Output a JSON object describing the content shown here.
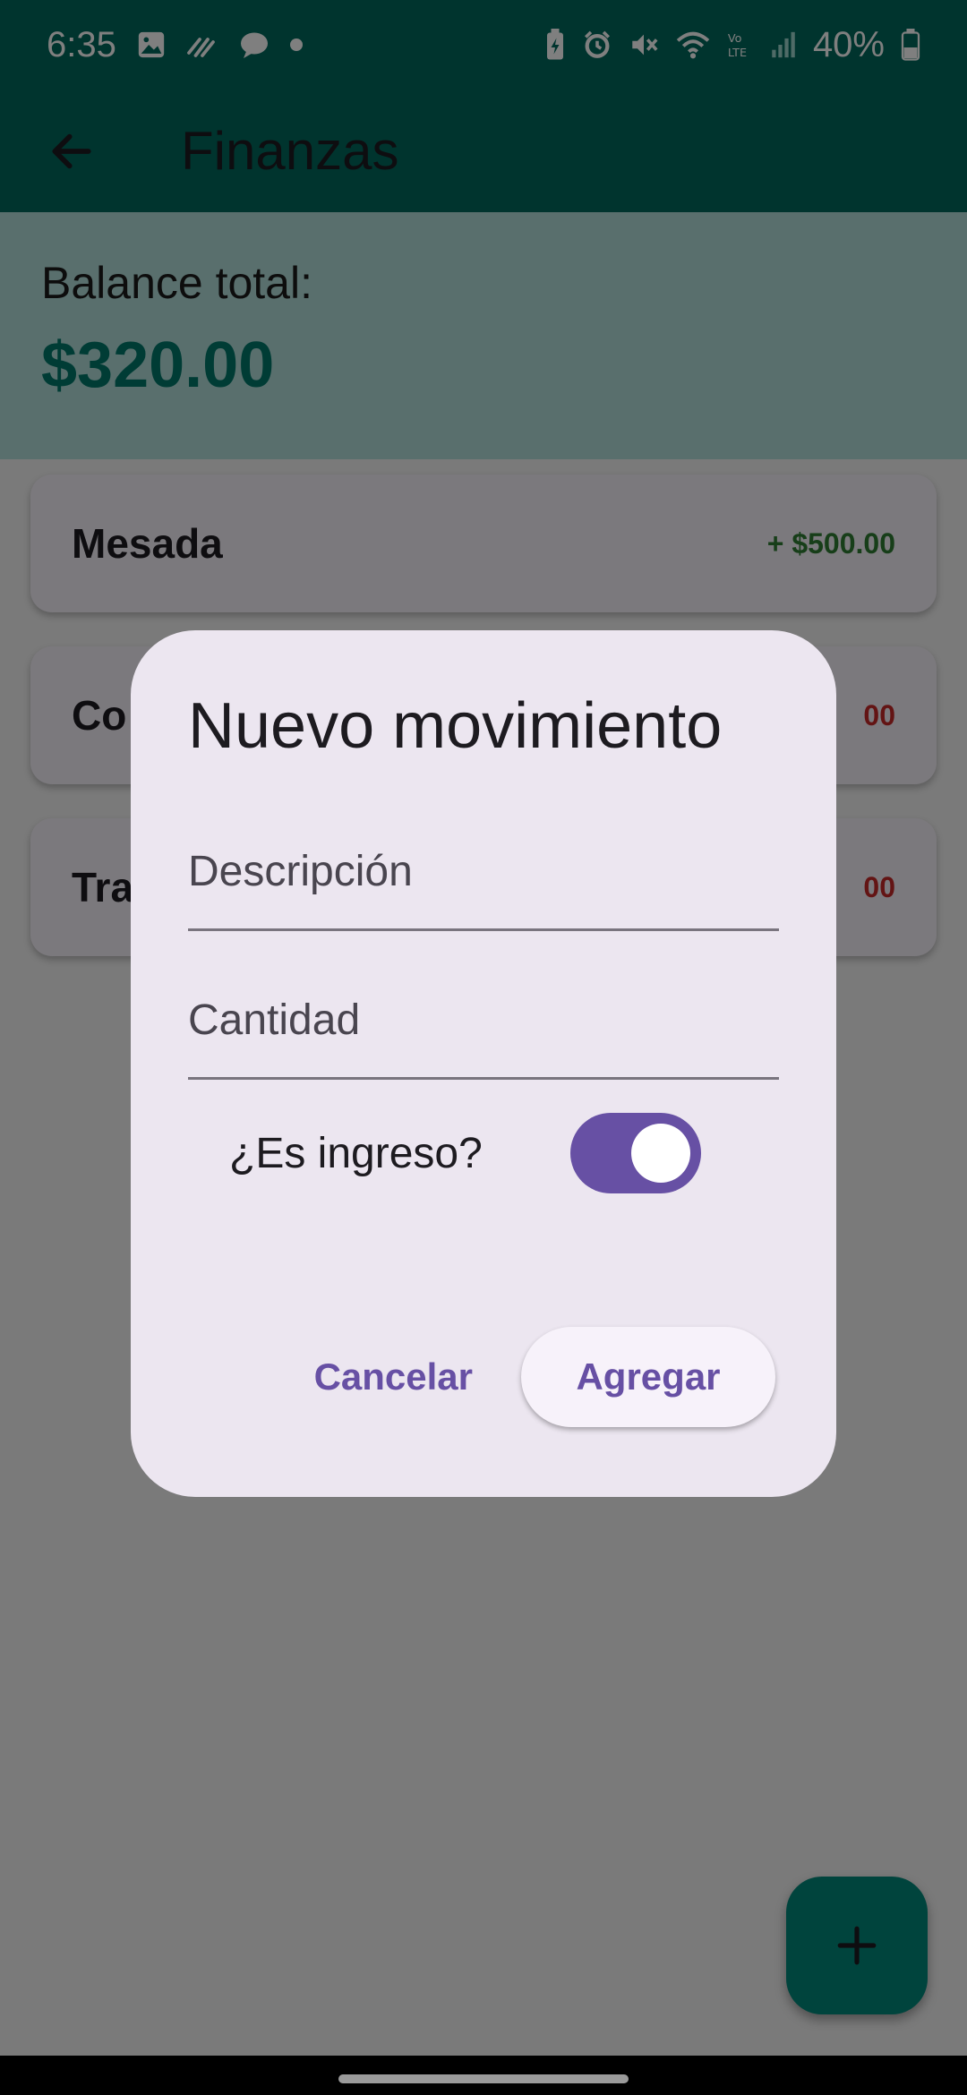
{
  "status_bar": {
    "time": "6:35",
    "battery": "40%",
    "icons_left": [
      "image-icon",
      "wind-icon",
      "chat-bubble-icon",
      "dot-icon"
    ],
    "icons_right": [
      "battery-saver-icon",
      "alarm-icon",
      "mute-icon",
      "wifi-icon",
      "volte-icon",
      "signal-icon",
      "battery-icon"
    ]
  },
  "app_bar": {
    "title": "Finanzas"
  },
  "balance": {
    "label": "Balance total:",
    "value": "$320.00"
  },
  "transactions": [
    {
      "description": "Mesada",
      "amount": "+ $500.00",
      "type": "income"
    },
    {
      "description": "Co",
      "amount": "00",
      "type": "expense"
    },
    {
      "description": "Tra",
      "amount": "00",
      "type": "expense"
    }
  ],
  "dialog": {
    "title": "Nuevo movimiento",
    "description_placeholder": "Descripción",
    "amount_placeholder": "Cantidad",
    "switch_label": "¿Es ingreso?",
    "switch_on": true,
    "cancel_label": "Cancelar",
    "add_label": "Agregar"
  },
  "colors": {
    "primary": "#00695c",
    "accent": "#6750a4",
    "income": "#2e7d32",
    "expense": "#c62828"
  }
}
